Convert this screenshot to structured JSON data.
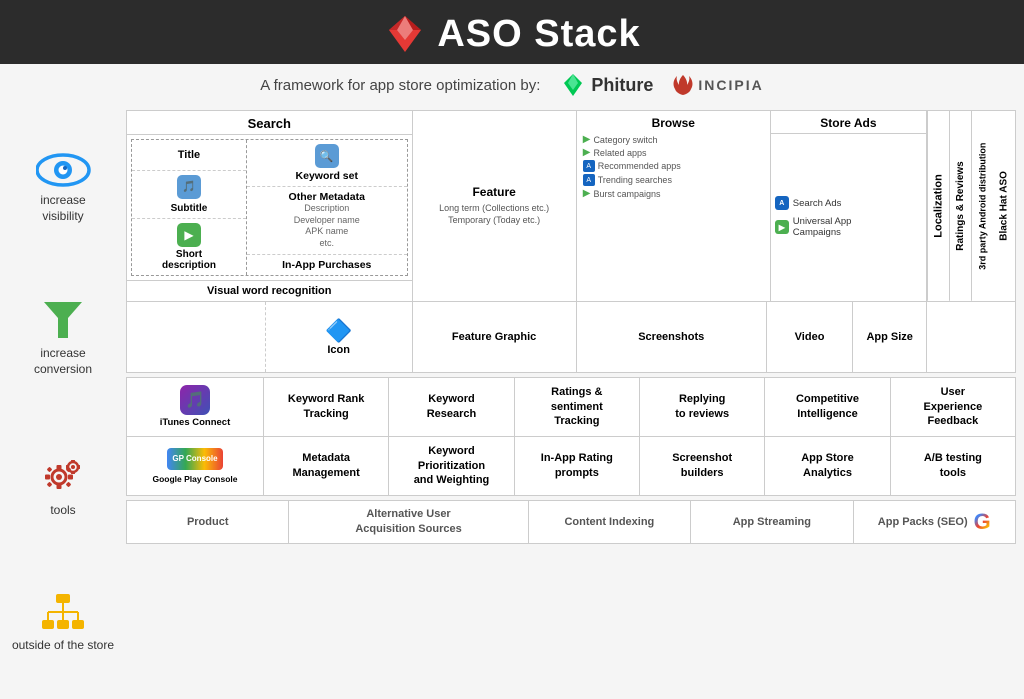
{
  "header": {
    "title": "ASO Stack",
    "subtitle": "A framework for app store optimization by:",
    "phiture": "Phiture",
    "incipia": "INCIPIA"
  },
  "sidebar": {
    "visibility": {
      "label": "increase\nvisibility"
    },
    "conversion": {
      "label": "increase\nconversion"
    },
    "tools": {
      "label": "tools"
    },
    "outside": {
      "label": "outside\nof the store"
    }
  },
  "framework": {
    "search_header": "Search",
    "title_label": "Title",
    "subtitle_label": "Subtitle",
    "short_desc_label": "Short\ndescription",
    "keyword_set_label": "Keyword set",
    "other_metadata_label": "Other Metadata",
    "other_metadata_sub": "Description\nDeveloper name\nAPK name\netc.",
    "in_app_purchases_label": "In-App Purchases",
    "visual_word_label": "Visual word recognition",
    "feature_label": "Feature",
    "feature_sub": "Long term (Collections etc.)\nTemporary (Today etc.)",
    "browse_header": "Browse",
    "browse_sub1": "Category switch",
    "browse_sub2": "Related apps",
    "browse_sub3": "Recommended apps",
    "browse_sub4": "Trending searches",
    "browse_sub5": "Burst campaigns",
    "store_ads_header": "Store Ads",
    "search_ads_label": "Search Ads",
    "universal_campaigns_label": "Universal App\nCampaigns",
    "localization_label": "Localization",
    "ratings_reviews_label": "Ratings & Reviews",
    "third_party_label": "3rd party Android distribution",
    "black_hat_label": "Black Hat ASO",
    "icon_label": "Icon",
    "feature_graphic_label": "Feature\nGraphic",
    "screenshots_label": "Screenshots",
    "video_label": "Video",
    "app_size_label": "App\nSize"
  },
  "tools": {
    "itunes_label": "iTunes Connect",
    "keyword_rank_label": "Keyword Rank\nTracking",
    "keyword_research_label": "Keyword\nResearch",
    "ratings_tracking_label": "Ratings &\nsentiment\nTracking",
    "replying_reviews_label": "Replying\nto reviews",
    "competitive_label": "Competitive\nIntelligence",
    "user_experience_label": "User\nExperience\nFeedback",
    "google_play_label": "Google Play Console",
    "metadata_mgmt_label": "Metadata\nManagement",
    "keyword_prior_label": "Keyword\nPrioritization\nand Weighting",
    "in_app_rating_label": "In-App Rating\nprompts",
    "screenshot_builders_label": "Screenshot\nbuilders",
    "app_store_analytics_label": "App Store\nAnalytics",
    "ab_testing_label": "A/B testing\ntools"
  },
  "bottom": {
    "product_label": "Product",
    "alt_acquisition_label": "Alternative User\nAcquisition Sources",
    "content_indexing_label": "Content Indexing",
    "app_streaming_label": "App Streaming",
    "app_packs_label": "App Packs (SEO)"
  }
}
